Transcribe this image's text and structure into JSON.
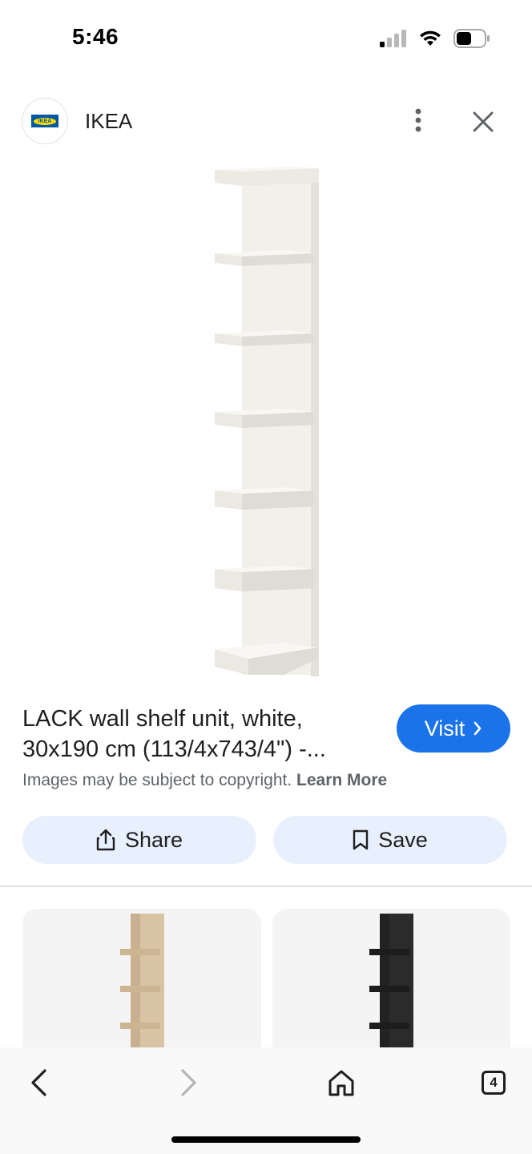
{
  "status_bar": {
    "time": "5:46",
    "icons": [
      "signal-icon",
      "wifi-icon",
      "battery-icon"
    ]
  },
  "header": {
    "logo_icon": "ikea-logo",
    "logo_text": "IKEA",
    "site_name": "IKEA",
    "more_icon": "more-vert-icon",
    "close_icon": "close-icon"
  },
  "product": {
    "title": "LACK wall shelf unit, white, 30x190 cm (113/4x743/4\") -...",
    "visit_label": "Visit",
    "copyright_text": "Images may be subject to copyright.",
    "learn_more_label": "Learn More"
  },
  "actions": {
    "share_label": "Share",
    "save_label": "Save"
  },
  "related": [
    {
      "color": "#d9c3a5"
    },
    {
      "color": "#2b2b2b"
    }
  ],
  "bottom_nav": {
    "tab_count": "4"
  },
  "colors": {
    "accent": "#1a73e8",
    "chip_background": "#e8f0fe"
  }
}
